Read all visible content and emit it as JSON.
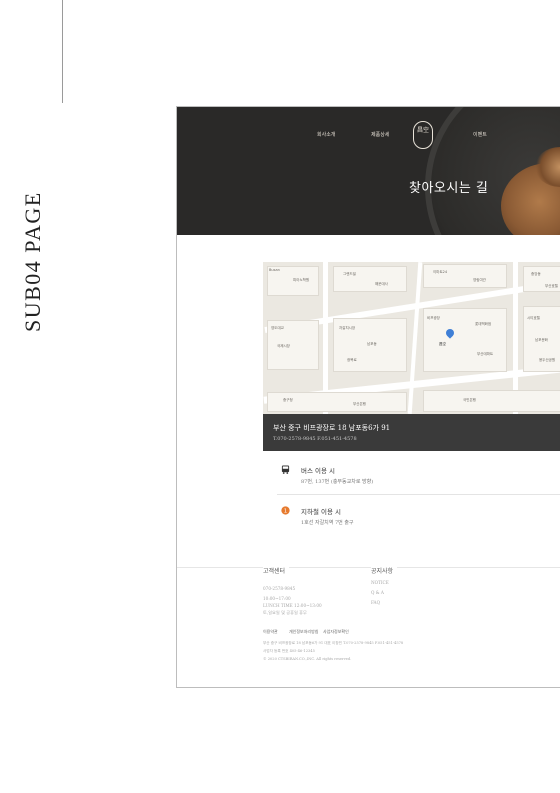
{
  "side": {
    "label": "SUB04 PAGE"
  },
  "nav": {
    "items": [
      "회사소개",
      "제품상세",
      "이벤트"
    ]
  },
  "logo": {
    "text": "昌空"
  },
  "hero": {
    "title": "찾아오시는 길"
  },
  "map": {
    "labels": [
      "Busan",
      "피아노학원",
      "그랜드빌",
      "해운대사",
      "이마트24",
      "영림여관",
      "중앙동",
      "부산호텔",
      "영도대교",
      "국제시장",
      "자갈치시장",
      "남포동",
      "광복로",
      "비프광장",
      "롯데백화점",
      "부산데파트",
      "시티호텔",
      "남포문화",
      "용두산공원",
      "중구청",
      "부산은행",
      "국민은행"
    ],
    "pin_label": "昌空"
  },
  "address": {
    "line1": "부산 중구 비프광장로 18 남포동6가 91",
    "line2": "T.070-2578-9845   F.051-451-4578"
  },
  "routes": [
    {
      "icon": "bus-icon",
      "title": "버스 이용 시",
      "desc": "87번, 137번 (충무동교차로 방향)"
    },
    {
      "icon": "subway-icon",
      "title": "지하철 이용 시",
      "desc": "1호선 자갈치역 7번 출구"
    }
  ],
  "footer": {
    "customer_title": "고객센터",
    "phone": "070-2578-9845",
    "hours": [
      "10:00~17:00",
      "LUNCH TIME 12:00~13:00",
      "토,일요일 및 공휴일 휴무"
    ],
    "notice_title": "공지사항",
    "notice_items": [
      "NOTICE",
      "Q & A",
      "FAQ"
    ],
    "links": [
      "이용약관",
      "개인정보처리방침",
      "사업자정보확인"
    ],
    "info_1": "부산 중구 비프광장로 18 남포동6가 91   대표 이창민   T.070-2578-9845   F.051-451-4578",
    "info_2": "사업자 등록 번호 405-46-12345",
    "copyright": "© 2020 CTSBIRAN.CO.,INC. All rights reserved."
  },
  "colors": {
    "hero_bg": "#2a2928",
    "address_bg": "#3a3a3a",
    "pin": "#3f7fd6",
    "subway_icon": "#e67a2e"
  }
}
